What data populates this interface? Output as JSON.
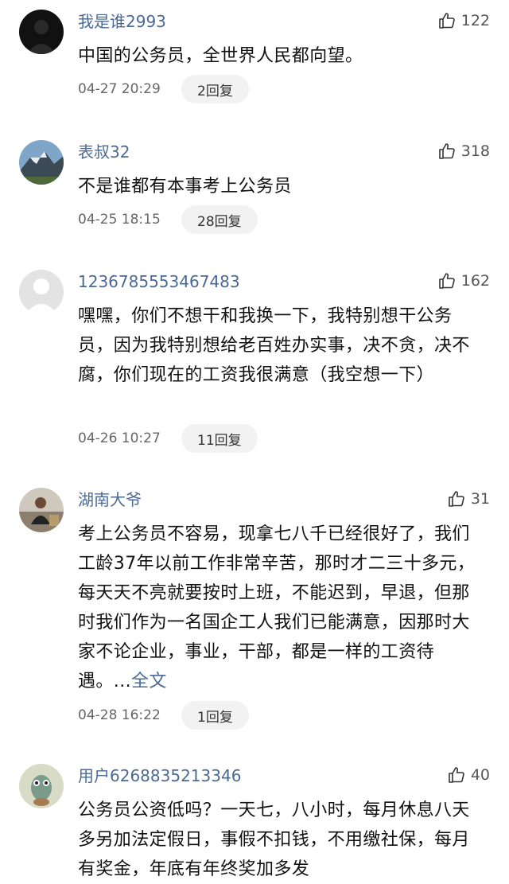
{
  "comments": [
    {
      "username": "我是谁2993",
      "likes": "122",
      "text": "中国的公务员，全世界人民都向望。",
      "more": "",
      "time": "04-27 20:29",
      "reply": "2回复"
    },
    {
      "username": "表叔32",
      "likes": "318",
      "text": "不是谁都有本事考上公务员",
      "more": "",
      "time": "04-25 18:15",
      "reply": "28回复"
    },
    {
      "username": "1236785553467483",
      "likes": "162",
      "text": "嘿嘿，你们不想干和我换一下，我特别想干公务员，因为我特别想给老百姓办实事，决不贪，决不腐，你们现在的工资我很满意（我空想一下）",
      "more": "",
      "time": "04-26 10:27",
      "reply": "11回复"
    },
    {
      "username": "湖南大爷",
      "likes": "31",
      "text": "考上公务员不容易，现拿七八千已经很好了，我们工龄37年以前工作非常辛苦，那时才二三十多元，每天天不亮就要按时上班，不能迟到，早退，但那时我们作为一名国企工人我们已能满意，因那时大家不论企业，事业，干部，都是一样的工资待遇。...",
      "more": "全文",
      "time": "04-28 16:22",
      "reply": "1回复"
    },
    {
      "username": "用户6268835213346",
      "likes": "40",
      "text": "公务员公资低吗？一天七，八小时，每月休息八天多另加法定假日，事假不扣钱，不用缴社保，每月有奖金，年底有年终奖加多发",
      "more": "",
      "time": "",
      "reply": ""
    }
  ],
  "icons": {
    "like": "thumbs-up-icon"
  }
}
